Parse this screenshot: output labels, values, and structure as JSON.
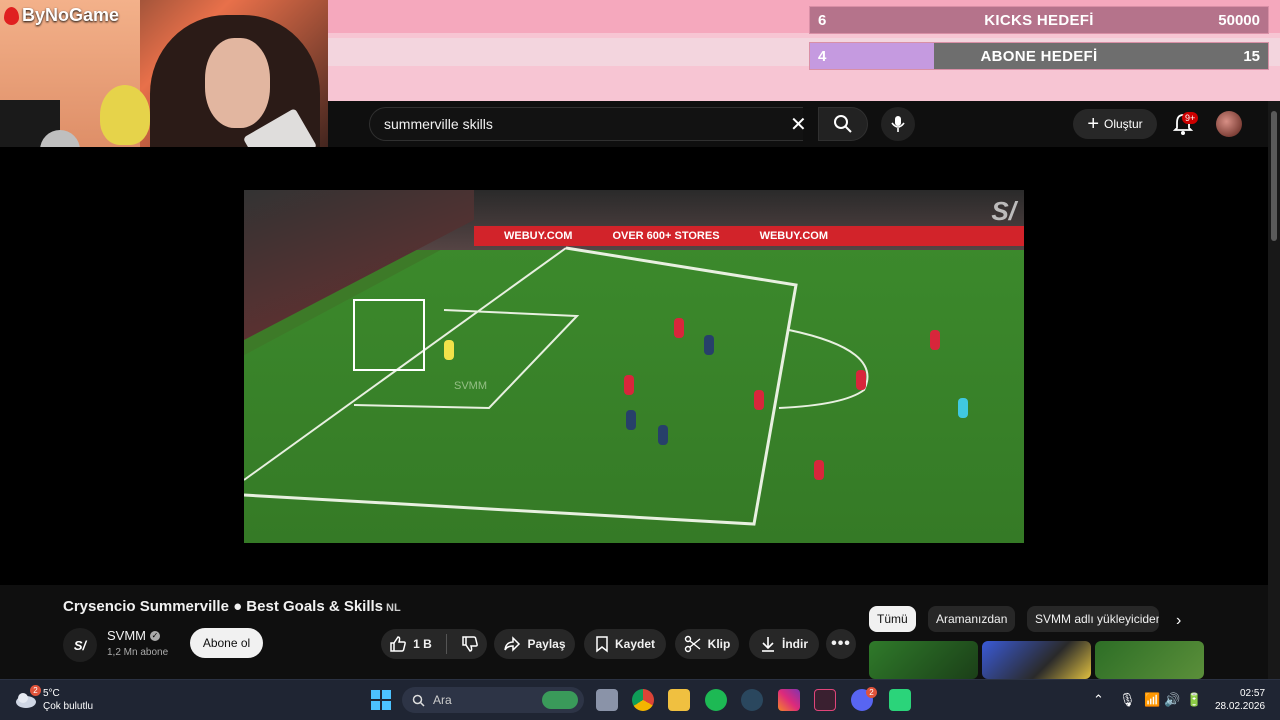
{
  "overlay": {
    "kicks_goal": {
      "current": "6",
      "title": "KICKS HEDEFİ",
      "target": "50000",
      "fill_fraction": 0.0
    },
    "sub_goal": {
      "current": "4",
      "title": "ABONE HEDEFİ",
      "target": "15",
      "fill_fraction": 0.27
    },
    "brand": "ByNoGame"
  },
  "youtube": {
    "search_value": "summerville skills",
    "create_label": "Oluştur",
    "notification_count": "9+",
    "video": {
      "title": "Crysencio Summerville ● Best Goals & Skills",
      "title_suffix": "NL",
      "video_watermark": "S/",
      "overlay_text": "SVMM",
      "ad_text": [
        "WEBUY.COM",
        "OVER 600+ STORES",
        "WEBUY.COM"
      ]
    },
    "channel": {
      "name": "SVMM",
      "avatar_text": "S/",
      "subscribers": "1,2 Mn abone",
      "subscribe_label": "Abone ol"
    },
    "actions": {
      "like_count": "1 B",
      "share": "Paylaş",
      "save": "Kaydet",
      "clip": "Klip",
      "download": "İndir"
    },
    "chips": [
      "Tümü",
      "Aramanızdan",
      "SVMM adlı yükleyiciden"
    ]
  },
  "taskbar": {
    "weather_temp": "5°C",
    "weather_desc": "Çok bulutlu",
    "weather_badge": "2",
    "search_placeholder": "Ara",
    "time": "02:57",
    "date": "28.02.2026",
    "discord_badge": "2"
  },
  "colors": {
    "yt_bg": "#0f0f0f",
    "overlay_pink": "#f7c5d3",
    "goal_purple": "#c59ae0",
    "taskbar": "#1f2533"
  }
}
